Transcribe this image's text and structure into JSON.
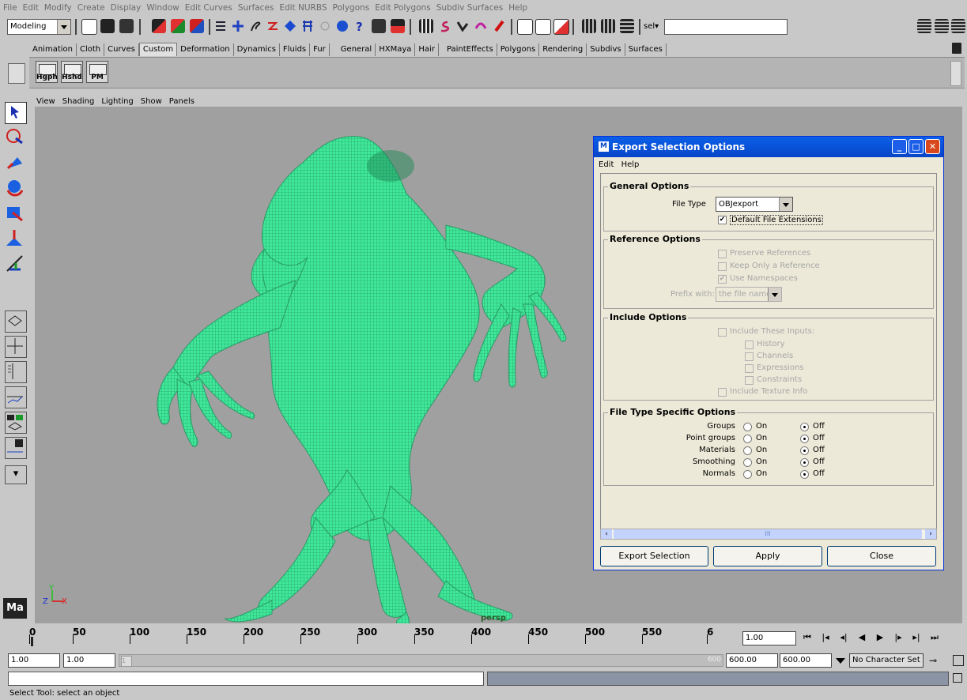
{
  "menubar": [
    "File",
    "Edit",
    "Modify",
    "Create",
    "Display",
    "Window",
    "Edit Curves",
    "Surfaces",
    "Edit NURBS",
    "Polygons",
    "Edit Polygons",
    "Subdiv Surfaces",
    "Help"
  ],
  "status_line": {
    "mode": "Modeling",
    "selection_mode": "sel▾",
    "input": ""
  },
  "shelf_tabs": [
    "Animation",
    "Cloth",
    "Curves",
    "Custom",
    "Deformation",
    "Dynamics",
    "Fluids",
    "Fur",
    "General",
    "HXMaya",
    "Hair",
    "PaintEffects",
    "Polygons",
    "Rendering",
    "Subdivs",
    "Surfaces"
  ],
  "active_shelf_tab": "Custom",
  "shelf_buttons": [
    "Hgph",
    "Hshd",
    "PM"
  ],
  "panel_menu": [
    "View",
    "Shading",
    "Lighting",
    "Show",
    "Panels"
  ],
  "viewport": {
    "camera": "persp",
    "axis_labels": {
      "y": "Y",
      "z": "Z",
      "x": "X"
    },
    "bg_color": "#a0a0a0",
    "wire_color": "#3fe89a"
  },
  "time_slider": {
    "ticks": [
      "0",
      "50",
      "100",
      "150",
      "200",
      "250",
      "300",
      "350",
      "400",
      "450",
      "500",
      "550",
      "6"
    ],
    "current": "1.00"
  },
  "range_slider": {
    "start": "1.00",
    "playback_start": "1.00",
    "range_start_label": "1",
    "range_end_label": "600",
    "playback_end": "600.00",
    "end": "600.00",
    "character_set": "No Character Set"
  },
  "help_line": "Select Tool: select an object",
  "dialog": {
    "title": "Export Selection Options",
    "menu": [
      "Edit",
      "Help"
    ],
    "general": {
      "title": "General Options",
      "file_type_label": "File Type",
      "file_type_value": "OBJexport",
      "default_ext_label": "Default File Extensions",
      "default_ext_checked": "✔"
    },
    "reference": {
      "title": "Reference Options",
      "preserve": "Preserve References",
      "keep_only": "Keep Only a Reference",
      "use_namespaces": "Use Namespaces",
      "use_namespaces_checked": "✔",
      "prefix_label": "Prefix with:",
      "prefix_value": "the file name"
    },
    "include": {
      "title": "Include Options",
      "inputs": "Include These Inputs:",
      "history": "History",
      "channels": "Channels",
      "expressions": "Expressions",
      "constraints": "Constraints",
      "texture": "Include Texture Info"
    },
    "filetype": {
      "title": "File Type Specific Options",
      "rows": [
        {
          "label": "Groups",
          "on": "On",
          "off": "Off"
        },
        {
          "label": "Point groups",
          "on": "On",
          "off": "Off"
        },
        {
          "label": "Materials",
          "on": "On",
          "off": "Off"
        },
        {
          "label": "Smoothing",
          "on": "On",
          "off": "Off"
        },
        {
          "label": "Normals",
          "on": "On",
          "off": "Off"
        }
      ],
      "selected": "Off"
    },
    "scroll_grip": "III",
    "buttons": {
      "export": "Export Selection",
      "apply": "Apply",
      "close": "Close"
    }
  }
}
